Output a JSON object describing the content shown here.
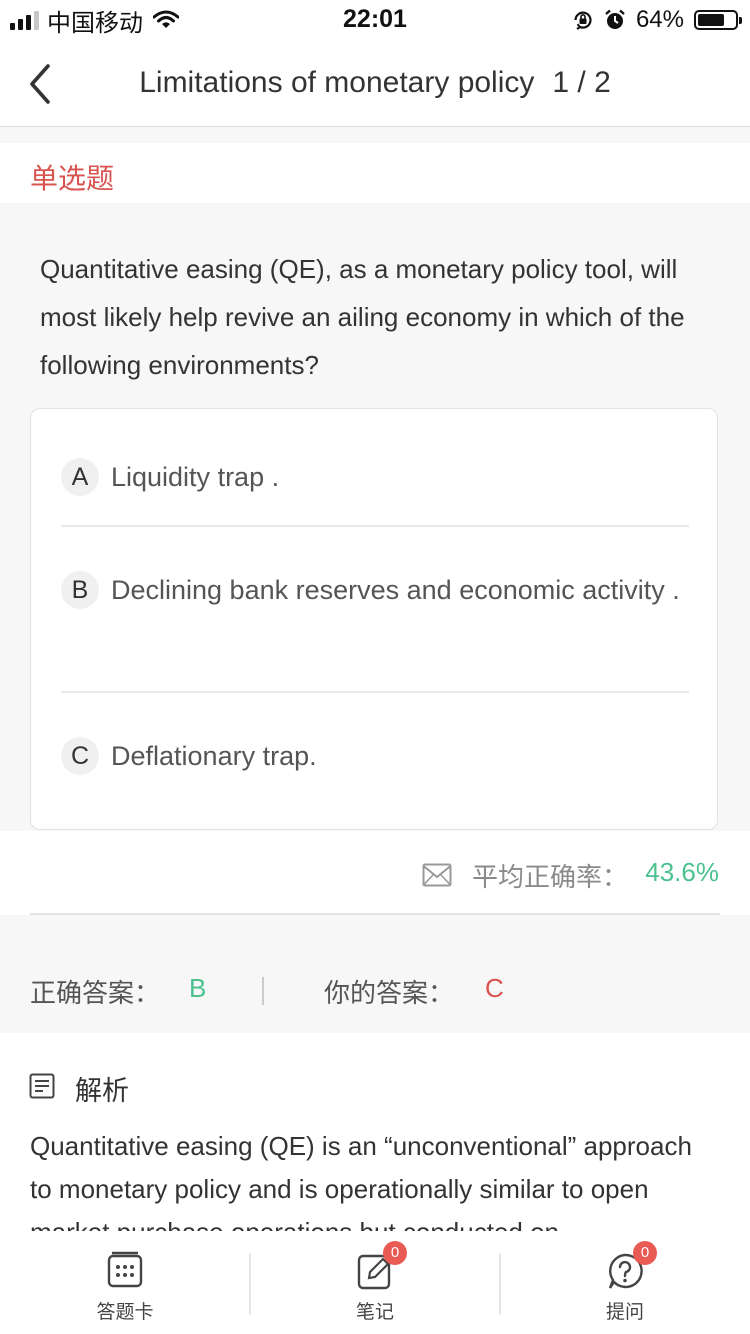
{
  "status_bar": {
    "carrier": "中国移动",
    "time": "22:01",
    "battery_percent": "64%",
    "battery_level": 0.64,
    "icons": [
      "signal-icon",
      "wifi-icon",
      "orientation-lock-icon",
      "alarm-icon",
      "battery-icon"
    ]
  },
  "header": {
    "title": "Limitations of monetary policy",
    "page_counter": "1 / 2",
    "back_icon": "chevron-left-icon"
  },
  "question": {
    "type": "单选题",
    "text": "Quantitative easing (QE), as a monetary policy tool, will most likely help revive an ailing economy in which of the following environments?",
    "options": [
      {
        "letter": "A",
        "text": "Liquidity trap ."
      },
      {
        "letter": "B",
        "text": "Declining bank reserves and economic activity ."
      },
      {
        "letter": "C",
        "text": "Deflationary trap."
      }
    ]
  },
  "stats": {
    "icon": "envelope-icon",
    "avg_label": "平均正确率：",
    "avg_value": "43.6%"
  },
  "answer": {
    "correct_label": "正确答案：",
    "correct_value": "B",
    "yours_label": "你的答案：",
    "yours_value": "C"
  },
  "analysis": {
    "icon": "document-icon",
    "title": "解析",
    "text": "Quantitative easing (QE) is an “unconventional” approach to monetary policy and is operationally similar to open market purchase operations but conducted on"
  },
  "tabbar": {
    "items": [
      {
        "label": "答题卡",
        "icon": "answer-card-icon",
        "badge": ""
      },
      {
        "label": "笔记",
        "icon": "note-edit-icon",
        "badge": "0"
      },
      {
        "label": "提问",
        "icon": "question-icon",
        "badge": "0"
      }
    ]
  },
  "colors": {
    "accent_red": "#d9534f",
    "accent_green": "#4cc28f",
    "badge_red": "#e85a53",
    "section_bg": "#f7f7f7"
  }
}
